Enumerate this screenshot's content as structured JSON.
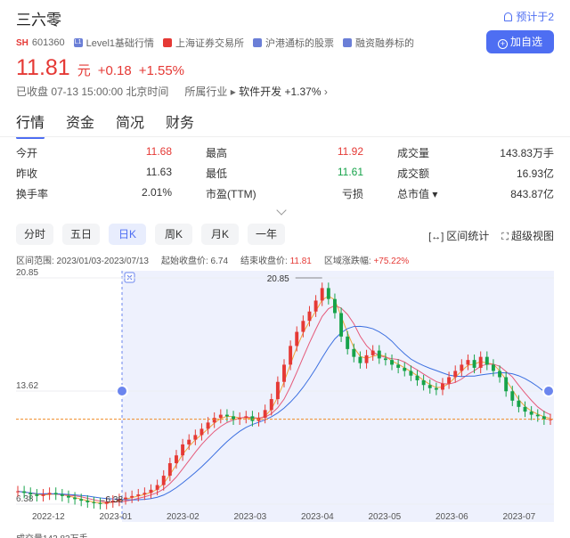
{
  "header": {
    "stock_name": "三六零",
    "alert_label": "预计于2",
    "market_tag": "SH",
    "code": "601360",
    "tags": [
      "Level1基础行情",
      "上海证券交易所",
      "沪港通标的股票",
      "融资融券标的"
    ],
    "follow_label": "加自选"
  },
  "quote": {
    "price": "11.81",
    "unit": "元",
    "change": "+0.18",
    "change_pct": "+1.55%",
    "status": "已收盘 07-13 15:00:00 北京时间",
    "industry_label": "所属行业",
    "industry_name": "软件开发",
    "industry_change": "+1.37%",
    "up_color": "#e53935",
    "down_color": "#16a34a"
  },
  "tabs": [
    "行情",
    "资金",
    "简况",
    "财务"
  ],
  "stats": [
    [
      {
        "label": "今开",
        "value": "11.68",
        "tone": "red"
      },
      {
        "label": "最高",
        "value": "11.92",
        "tone": "red"
      },
      {
        "label": "成交量",
        "value": "143.83万手",
        "tone": ""
      }
    ],
    [
      {
        "label": "昨收",
        "value": "11.63",
        "tone": ""
      },
      {
        "label": "最低",
        "value": "11.61",
        "tone": "green"
      },
      {
        "label": "成交额",
        "value": "16.93亿",
        "tone": ""
      }
    ],
    [
      {
        "label": "换手率",
        "value": "2.01%",
        "tone": ""
      },
      {
        "label": "市盈(TTM)",
        "value": "亏损",
        "tone": ""
      },
      {
        "label": "总市值 ▾",
        "value": "843.87亿",
        "tone": ""
      }
    ]
  ],
  "periods": [
    "分时",
    "五日",
    "日K",
    "周K",
    "月K",
    "一年"
  ],
  "active_period": 2,
  "tools": {
    "range_stats": "区间统计",
    "super_view": "超级视图"
  },
  "range_info": {
    "range": "区间范围: 2023/01/03-2023/07/13",
    "start": "起始收盘价: 6.74",
    "end_label": "结束收盘价:",
    "end_value": "11.81",
    "change_label": "区域涨跌幅:",
    "change_value": "+75.22%"
  },
  "volume_label": "成交量143.83万手",
  "chart_data": {
    "type": "candlestick",
    "y_ticks": [
      "20.85",
      "13.62",
      "6.38"
    ],
    "x_ticks": [
      "2022-12",
      "2023-01",
      "2023-02",
      "2023-03",
      "2023-04",
      "2023-05",
      "2023-06",
      "2023-07"
    ],
    "ylim": [
      6.38,
      20.85
    ],
    "max_label": "20.85",
    "min_label": "6.38",
    "last_close": 11.81,
    "closes": [
      7.2,
      7.1,
      7.0,
      6.9,
      7.0,
      7.1,
      7.0,
      6.9,
      6.8,
      6.7,
      6.6,
      6.5,
      6.45,
      6.4,
      6.5,
      6.6,
      6.7,
      6.8,
      6.9,
      7.0,
      7.1,
      7.3,
      7.6,
      8.2,
      9.0,
      9.5,
      10.2,
      10.5,
      10.8,
      11.2,
      11.6,
      11.9,
      12.1,
      12.0,
      11.8,
      11.9,
      12.0,
      11.7,
      11.9,
      12.4,
      13.1,
      14.2,
      15.3,
      16.5,
      17.4,
      18.1,
      18.7,
      19.4,
      20.2,
      19.5,
      18.6,
      17.1,
      16.3,
      15.8,
      15.4,
      15.9,
      16.2,
      15.7,
      15.6,
      15.3,
      15.1,
      14.9,
      14.6,
      14.3,
      14.0,
      13.8,
      13.7,
      14.1,
      14.5,
      14.9,
      15.3,
      15.6,
      15.1,
      15.8,
      15.3,
      14.9,
      14.5,
      13.6,
      13.0,
      12.6,
      12.3,
      12.1,
      12.0,
      11.8,
      11.81
    ]
  }
}
